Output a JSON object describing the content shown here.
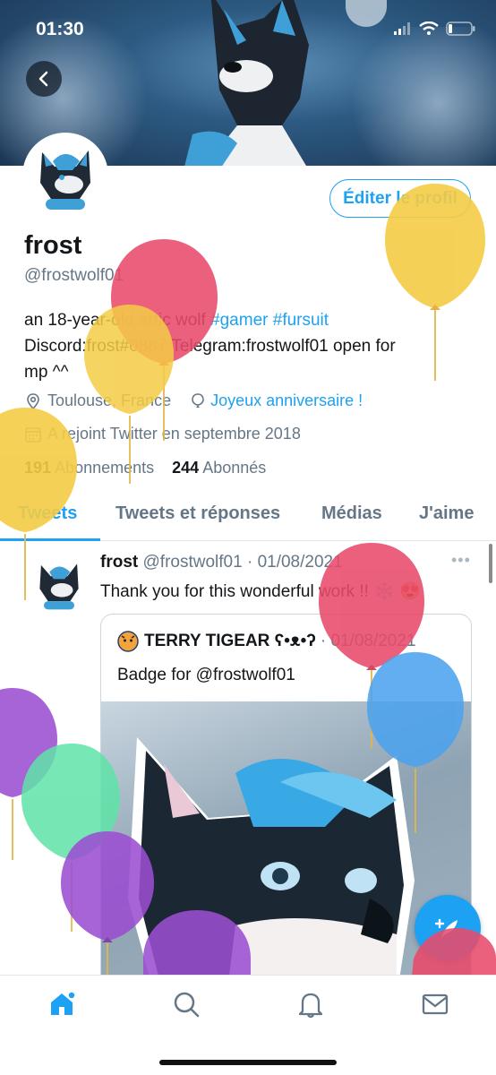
{
  "status_bar": {
    "time": "01:30"
  },
  "profile": {
    "name": "frost",
    "handle": "@frostwolf01",
    "edit_button": "Éditer le profil",
    "bio_line1_text": "an 18-year-old artic wolf",
    "bio_tag1": "#gamer",
    "bio_tag2": "#fursuit",
    "bio_line2": "Discord:frost#0867 Telegram:frostwolf01 open for",
    "bio_line3": "mp ^^",
    "location": "Toulouse, France",
    "birthday": "Joyeux anniversaire !",
    "joined": "A rejoint Twitter en septembre 2018",
    "following_count": "191",
    "following_label": "Abonnements",
    "followers_count": "244",
    "followers_label": "Abonnés"
  },
  "tabs": [
    "Tweets",
    "Tweets et réponses",
    "Médias",
    "J'aime"
  ],
  "tweet": {
    "author": "frost",
    "handle": "@frostwolf01",
    "date": "· 01/08/2021",
    "text": "Thank you for this wonderful work !! ❄️ 😍",
    "more": "•••",
    "quote": {
      "author": "TERRY TIGEAR ʕ•ᴥ•ʔ",
      "date": "· 01/08/2021",
      "text": "Badge for @frostwolf01"
    }
  },
  "colors": {
    "accent": "#1da1f2",
    "balloon_red": "#e84a6b",
    "balloon_yellow": "#f5cc45",
    "balloon_blue": "#4da3ee",
    "balloon_purple": "#9b4fd1",
    "balloon_green": "#5fe3a8"
  },
  "icons": {
    "back": "chevron-left-icon",
    "location": "location-pin-icon",
    "birthday": "balloon-icon",
    "joined": "calendar-icon",
    "compose": "feather-plus-icon",
    "nav": [
      "home-icon",
      "search-icon",
      "bell-icon",
      "mail-icon"
    ]
  }
}
